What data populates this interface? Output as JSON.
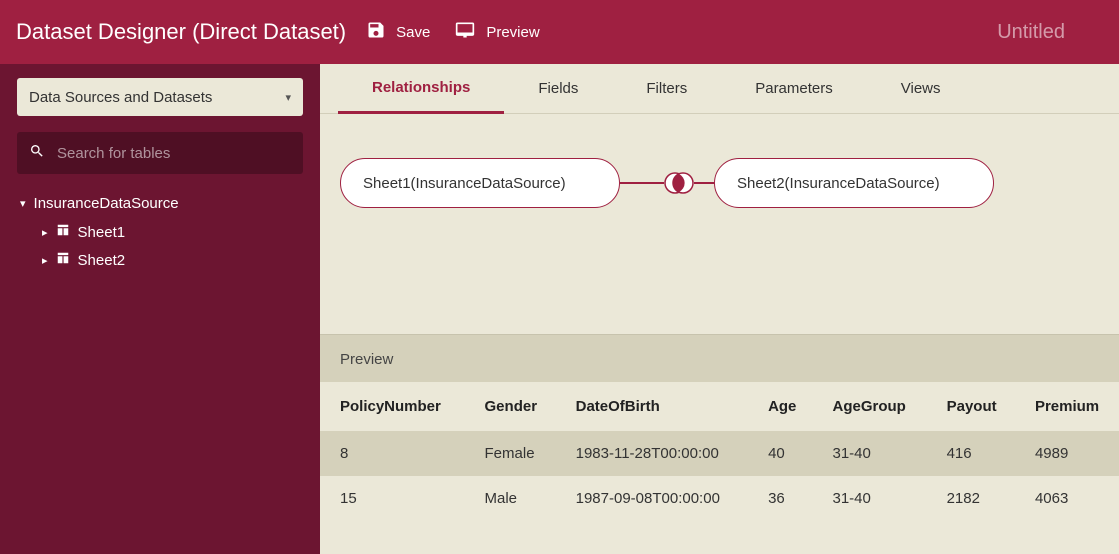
{
  "header": {
    "title": "Dataset Designer (Direct Dataset)",
    "save_label": "Save",
    "preview_label": "Preview",
    "doc_title": "Untitled"
  },
  "sidebar": {
    "selector_label": "Data Sources and Datasets",
    "search_placeholder": "Search for tables",
    "datasource": {
      "name": "InsuranceDataSource",
      "tables": [
        "Sheet1",
        "Sheet2"
      ]
    }
  },
  "tabs": {
    "items": [
      "Relationships",
      "Fields",
      "Filters",
      "Parameters",
      "Views"
    ],
    "active_index": 0
  },
  "relationships": {
    "left": "Sheet1(InsuranceDataSource)",
    "right": "Sheet2(InsuranceDataSource)",
    "join_type": "inner"
  },
  "preview": {
    "title": "Preview",
    "columns": [
      "PolicyNumber",
      "Gender",
      "DateOfBirth",
      "Age",
      "AgeGroup",
      "Payout",
      "Premium"
    ],
    "rows": [
      [
        "8",
        "Female",
        "1983-11-28T00:00:00",
        "40",
        "31-40",
        "416",
        "4989"
      ],
      [
        "15",
        "Male",
        "1987-09-08T00:00:00",
        "36",
        "31-40",
        "2182",
        "4063"
      ]
    ]
  }
}
